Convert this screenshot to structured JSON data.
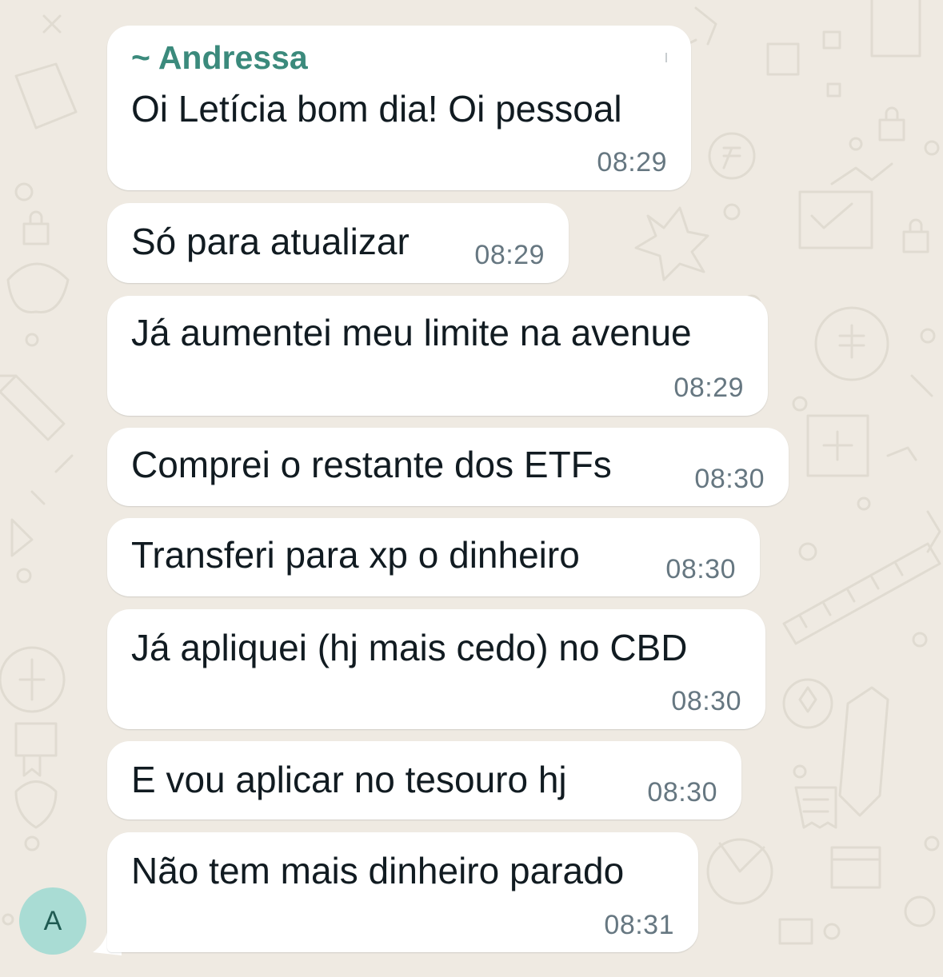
{
  "chat": {
    "avatar_initial": "A",
    "messages": [
      {
        "sender": "~ Andressa",
        "text": "Oi Letícia bom dia! Oi pessoal",
        "time": "08:29"
      },
      {
        "text": "Só para atualizar",
        "time": "08:29"
      },
      {
        "text": "Já aumentei meu limite na avenue",
        "time": "08:29"
      },
      {
        "text": "Comprei o restante dos ETFs",
        "time": "08:30"
      },
      {
        "text": "Transferi para xp o dinheiro",
        "time": "08:30"
      },
      {
        "text": "Já apliquei (hj mais cedo) no CBD",
        "time": "08:30"
      },
      {
        "text": "E vou aplicar no tesouro hj",
        "time": "08:30"
      },
      {
        "text": "Não tem mais dinheiro parado",
        "time": "08:31"
      }
    ]
  },
  "colors": {
    "background": "#efeae2",
    "bubble": "#ffffff",
    "sender_name": "#3b8a7c",
    "message_text": "#111b21",
    "timestamp": "#667781",
    "avatar_bg": "#a9dcd4"
  },
  "icons": [
    "chat-wallpaper-doodles"
  ]
}
